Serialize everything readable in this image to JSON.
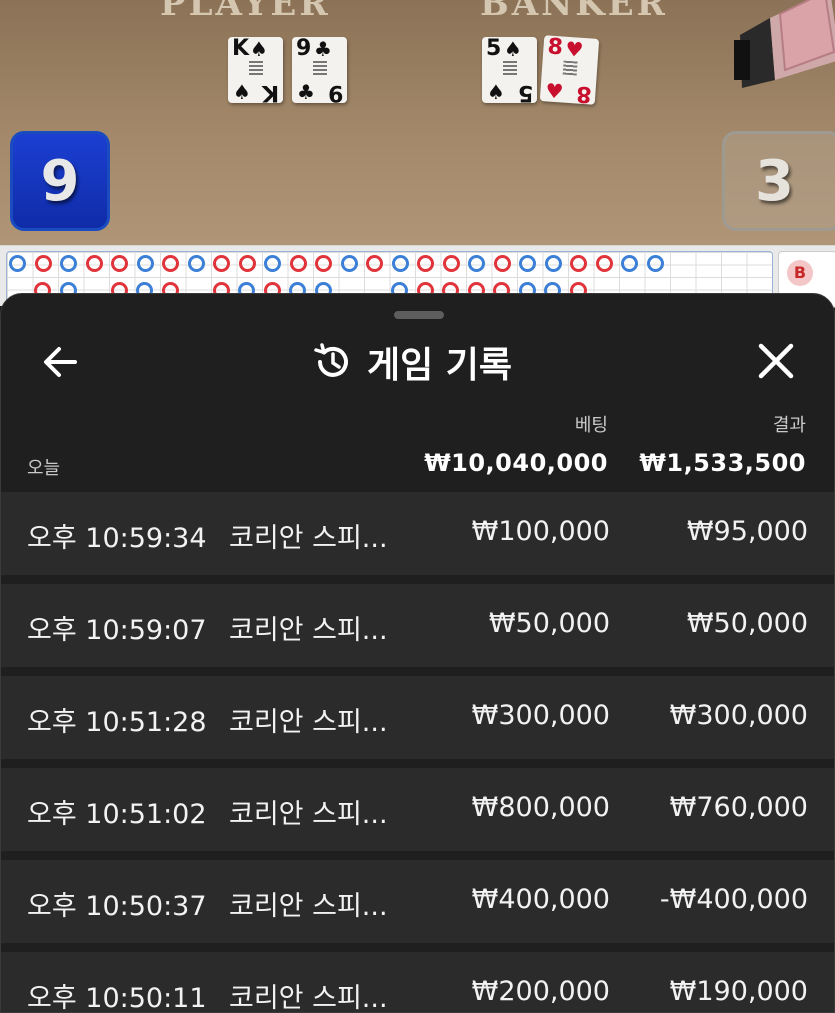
{
  "table": {
    "player_label": "PLAYER",
    "banker_label": "BANKER",
    "player_cards": [
      {
        "rank": "K",
        "suit": "♠",
        "color": "black"
      },
      {
        "rank": "9",
        "suit": "♣",
        "color": "black"
      }
    ],
    "banker_cards": [
      {
        "rank": "5",
        "suit": "♠",
        "color": "black"
      },
      {
        "rank": "8",
        "suit": "♥",
        "color": "red"
      }
    ],
    "player_score": "9",
    "banker_score": "3"
  },
  "road": {
    "badge": "B",
    "ring_colors": {
      "red": "#e0333a",
      "blue": "#3b7fd6"
    }
  },
  "history": {
    "title": "게임 기록",
    "back_icon": "arrow-left-icon",
    "title_icon": "history-icon",
    "close_icon": "close-icon",
    "bet_header": "베팅",
    "result_header": "결과",
    "today_label": "오늘",
    "total_bet": "₩10,040,000",
    "total_result": "₩1,533,500",
    "rows": [
      {
        "time": "오후 10:59:34",
        "game": "코리안 스피...",
        "bet": "₩100,000",
        "result": "₩95,000"
      },
      {
        "time": "오후 10:59:07",
        "game": "코리안 스피...",
        "bet": "₩50,000",
        "result": "₩50,000"
      },
      {
        "time": "오후 10:51:28",
        "game": "코리안 스피...",
        "bet": "₩300,000",
        "result": "₩300,000"
      },
      {
        "time": "오후 10:51:02",
        "game": "코리안 스피...",
        "bet": "₩800,000",
        "result": "₩760,000"
      },
      {
        "time": "오후 10:50:37",
        "game": "코리안 스피...",
        "bet": "₩400,000",
        "result": "-₩400,000"
      },
      {
        "time": "오후 10:50:11",
        "game": "코리안 스피...",
        "bet": "₩200,000",
        "result": "₩190,000"
      }
    ]
  }
}
